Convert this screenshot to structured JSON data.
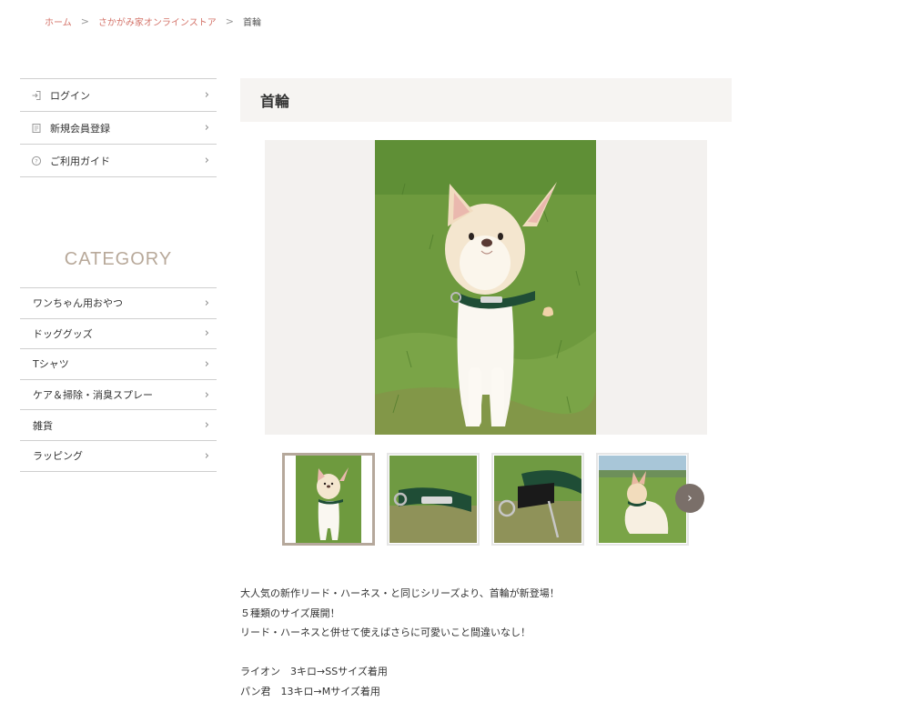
{
  "breadcrumb": {
    "home": "ホーム",
    "store": "さかがみ家オンラインストア",
    "current": "首輪",
    "separator": ">"
  },
  "user_menu": [
    {
      "label": "ログイン",
      "icon": "login-icon"
    },
    {
      "label": "新規会員登録",
      "icon": "register-icon"
    },
    {
      "label": "ご利用ガイド",
      "icon": "help-icon"
    }
  ],
  "category": {
    "title": "CATEGORY",
    "items": [
      {
        "label": "ワンちゃん用おやつ"
      },
      {
        "label": "ドッググッズ"
      },
      {
        "label": "Tシャツ"
      },
      {
        "label": "ケア＆掃除・消臭スプレー"
      },
      {
        "label": "雑貨"
      },
      {
        "label": "ラッピング"
      }
    ]
  },
  "product": {
    "title": "首輪",
    "description": [
      "大人気の新作リード・ハーネス・と同じシリーズより、首輪が新登場！",
      "５種類のサイズ展開！",
      "リード・ハーネスと併せて使えばさらに可愛いこと間違いなし！",
      "",
      "ライオン　3キロ→SSサイズ着用",
      "パン君　13キロ→Mサイズ着用"
    ]
  },
  "colors": {
    "accent_link": "#d4746a",
    "title_bg": "#f6f4f2",
    "category_title": "#b8a99a",
    "collar_green": "#1f4d36",
    "next_button": "#7a6f69"
  }
}
